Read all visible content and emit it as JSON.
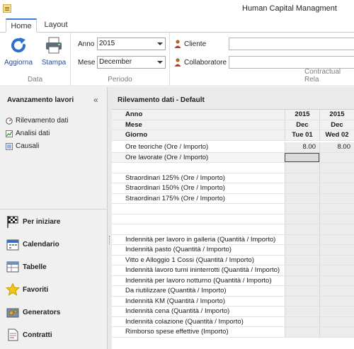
{
  "window": {
    "title": "Human Capital Managment"
  },
  "tabs": [
    {
      "label": "Home",
      "active": true
    },
    {
      "label": "Layout",
      "active": false
    }
  ],
  "ribbon": {
    "data_group": {
      "label": "Data",
      "buttons": [
        {
          "label": "Aggiorna",
          "icon": "refresh-icon"
        },
        {
          "label": "Stampa",
          "icon": "printer-icon"
        }
      ]
    },
    "periodo_group": {
      "label": "Periodo",
      "anno_label": "Anno",
      "anno_value": "2015",
      "mese_label": "Mese",
      "mese_value": "December"
    },
    "contractual_group": {
      "label": "Contractual Rela",
      "cliente_label": "Cliente",
      "collaboratore_label": "Collaboratore",
      "cliente_value": "",
      "collaboratore_value": ""
    }
  },
  "left_panel": {
    "title": "Avanzamento lavori",
    "collapse_glyph": "«",
    "items": [
      {
        "label": "Rilevamento dati",
        "icon": "gauge-icon"
      },
      {
        "label": "Analisi dati",
        "icon": "line-chart-icon"
      },
      {
        "label": "Causali",
        "icon": "list-icon"
      }
    ],
    "nav": [
      {
        "label": "Per iniziare",
        "icon": "checkered-flag-icon"
      },
      {
        "label": "Calendario",
        "icon": "calendar-icon"
      },
      {
        "label": "Tabelle",
        "icon": "table-icon"
      },
      {
        "label": "Favoriti",
        "icon": "star-icon"
      },
      {
        "label": "Generators",
        "icon": "gears-icon"
      },
      {
        "label": "Contratti",
        "icon": "document-icon"
      }
    ]
  },
  "main": {
    "title": "Rilevamento dati - Default",
    "header_rows": [
      {
        "label": "Anno",
        "col1": "2015",
        "col2": "2015"
      },
      {
        "label": "Mese",
        "col1": "Dec",
        "col2": "Dec"
      },
      {
        "label": "Giorno",
        "col1": "Tue 01",
        "col2": "Wed 02"
      }
    ],
    "rows": [
      {
        "label": "Ore teoriche (Ore / Importo)",
        "col1": "8.00",
        "col2": "8.00"
      },
      {
        "label": "Ore lavorate (Ore / Importo)",
        "col1": "",
        "col2": ""
      },
      {
        "label": "",
        "col1": "",
        "col2": ""
      },
      {
        "label": "Straordinari 125% (Ore / Importo)",
        "col1": "",
        "col2": ""
      },
      {
        "label": "Straordinari 150% (Ore / Importo)",
        "col1": "",
        "col2": ""
      },
      {
        "label": "Straordinari 175% (Ore / Importo)",
        "col1": "",
        "col2": ""
      },
      {
        "label": "",
        "col1": "",
        "col2": ""
      },
      {
        "label": "",
        "col1": "",
        "col2": ""
      },
      {
        "label": "",
        "col1": "",
        "col2": ""
      },
      {
        "label": "Indennità per lavoro in galleria (Quantità / Importo)",
        "col1": "",
        "col2": ""
      },
      {
        "label": "Indennità pasto (Quantità / Importo)",
        "col1": "",
        "col2": ""
      },
      {
        "label": "Vitto e Alloggio 1 Cossi (Quantità / Importo)",
        "col1": "",
        "col2": ""
      },
      {
        "label": "Indennità lavoro turni ininterrotti (Quantità / Importo)",
        "col1": "",
        "col2": ""
      },
      {
        "label": "Indennità per lavoro notturno (Quantità / Importo)",
        "col1": "",
        "col2": ""
      },
      {
        "label": "Da riutilizzare (Quantità / Importo)",
        "col1": "",
        "col2": ""
      },
      {
        "label": "Indennità KM (Quantità / Importo)",
        "col1": "",
        "col2": ""
      },
      {
        "label": "Indennità cena (Quantità / Importo)",
        "col1": "",
        "col2": ""
      },
      {
        "label": "Indennità colazione (Quantità / Importo)",
        "col1": "",
        "col2": ""
      },
      {
        "label": "Rimborso spese effettive (Importo)",
        "col1": "",
        "col2": ""
      }
    ]
  }
}
